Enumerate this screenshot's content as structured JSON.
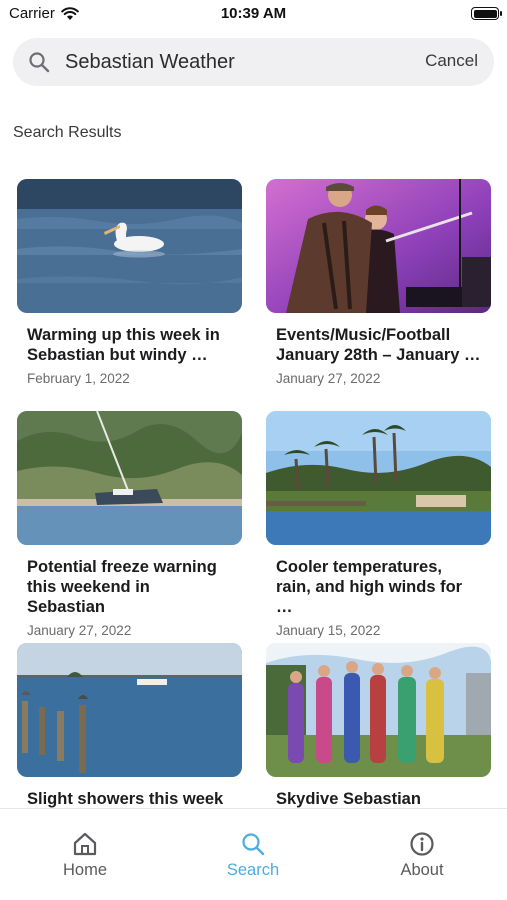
{
  "status_bar": {
    "carrier": "Carrier",
    "time": "10:39 AM"
  },
  "search": {
    "value": "Sebastian Weather",
    "cancel_label": "Cancel"
  },
  "section_title": "Search Results",
  "results": [
    {
      "title": "Warming up this week in Sebastian but windy …",
      "date": "February 1, 2022",
      "image": "pelican-on-water"
    },
    {
      "title": "Events/Music/Football January 28th – January …",
      "date": "January 27, 2022",
      "image": "concert-performers"
    },
    {
      "title": "Potential freeze warning this weekend in Sebastian",
      "date": "January 27, 2022",
      "image": "grounded-sailboat"
    },
    {
      "title": "Cooler temperatures, rain, and high winds for …",
      "date": "January 15, 2022",
      "image": "palm-tree-shoreline"
    },
    {
      "title": "Slight showers this week",
      "date": "",
      "image": "river-pilings"
    },
    {
      "title": "Skydive Sebastian",
      "date": "",
      "image": "costumed-group"
    }
  ],
  "tabs": [
    {
      "label": "Home",
      "icon": "home-icon",
      "active": false
    },
    {
      "label": "Search",
      "icon": "search-icon",
      "active": true
    },
    {
      "label": "About",
      "icon": "info-icon",
      "active": false
    }
  ],
  "colors": {
    "accent": "#4aaee0",
    "search_bg": "#f0f0f2"
  }
}
